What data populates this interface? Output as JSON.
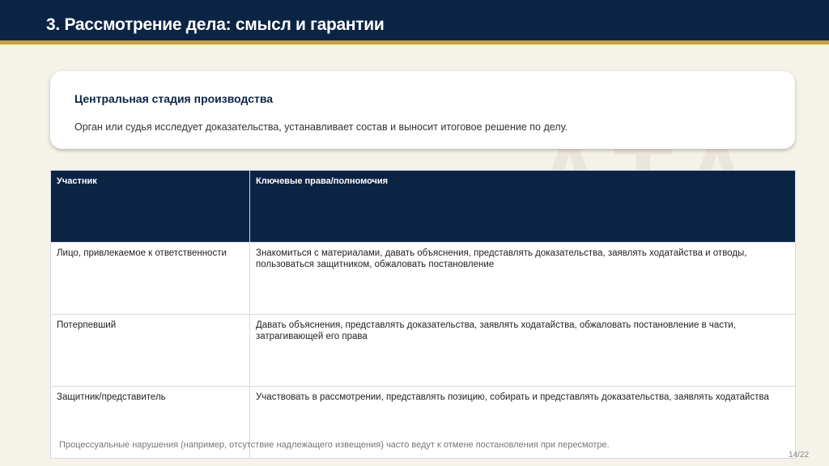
{
  "header": {
    "title": "3. Рассмотрение дела: смысл и гарантии"
  },
  "card": {
    "title": "Центральная стадия производства",
    "text": "Орган или судья исследует доказательства, устанавливает состав и выносит итоговое решение по делу."
  },
  "table": {
    "headers": [
      "Участник",
      "Ключевые права/полномочия"
    ],
    "rows": [
      [
        "Лицо, привлекаемое к ответственности",
        "Знакомиться с материалами, давать объяснения, представлять доказательства, заявлять ходатайства и отводы, пользоваться защитником, обжаловать постановление"
      ],
      [
        "Потерпевший",
        "Давать объяснения, представлять доказательства, заявлять ходатайства, обжаловать постановление в части, затрагивающей его права"
      ],
      [
        "Защитник/представитель",
        "Участвовать в рассмотрении, представлять позицию, собирать и представлять доказательства, заявлять ходатайства"
      ]
    ]
  },
  "footer": {
    "note": "Процессуальные нарушения (например, отсутствие надлежащего извещения) часто ведут к отмене постановления при пересмотре.",
    "page": "14/22"
  },
  "colors": {
    "navy": "#0c2444",
    "gold": "#c9a43a"
  }
}
